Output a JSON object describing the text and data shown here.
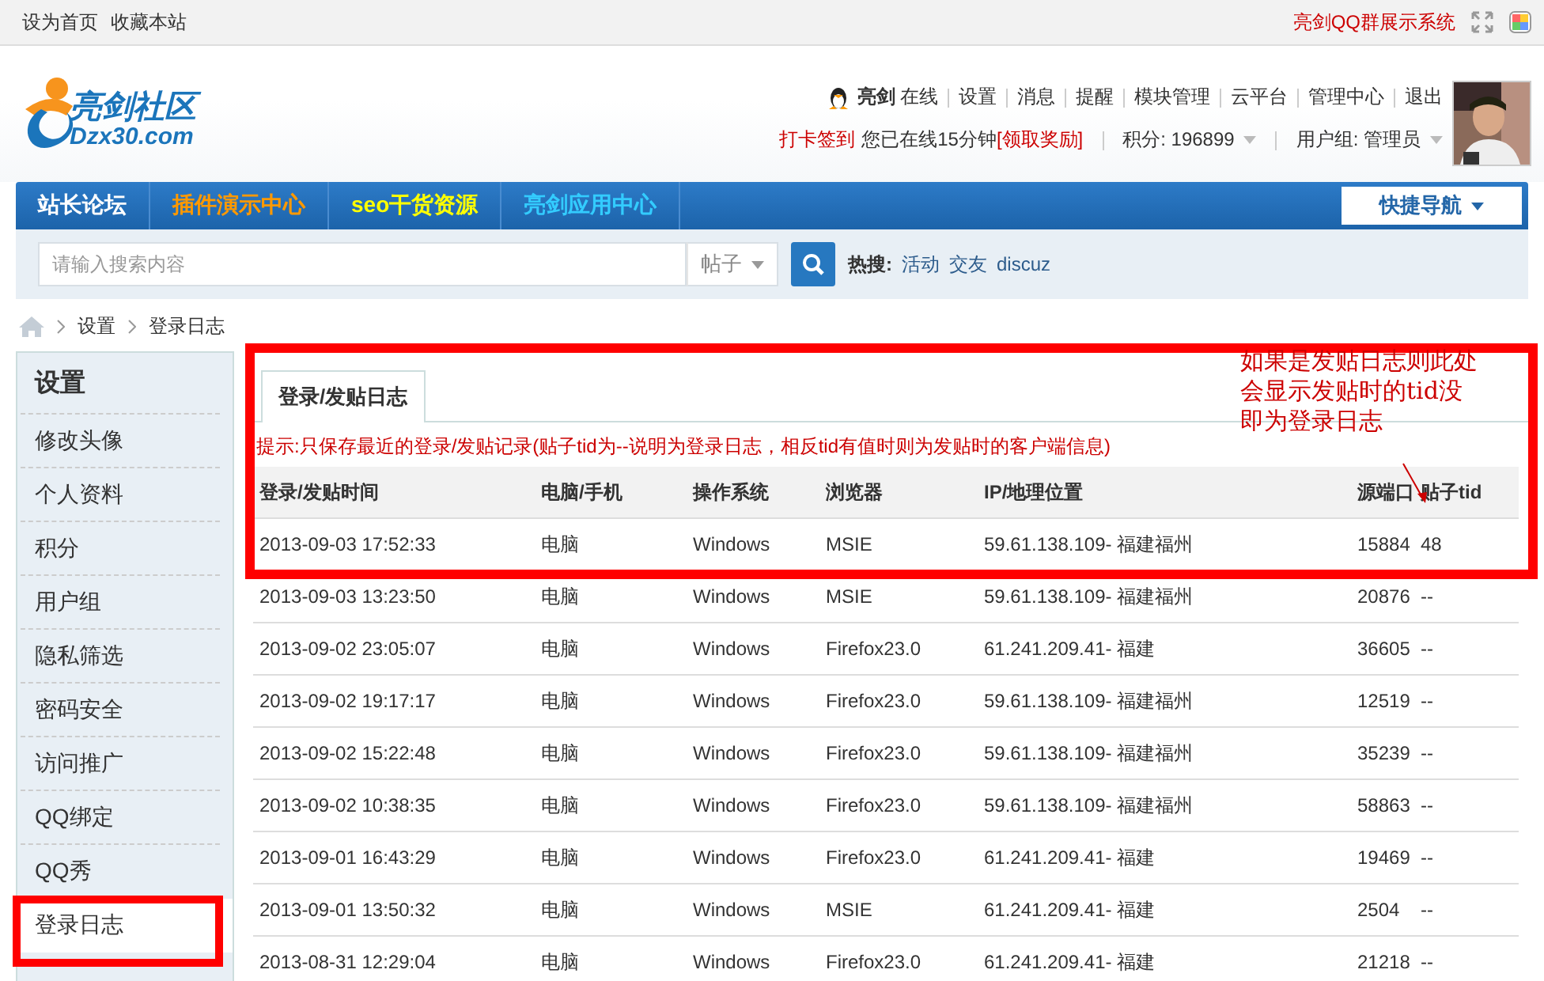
{
  "top_bar": {
    "links": [
      "设为首页",
      "收藏本站"
    ],
    "right_link": "亮剑QQ群展示系统"
  },
  "header": {
    "logo": {
      "title": "亮剑社区",
      "domain": "Dzx30.com"
    },
    "user": {
      "name": "亮剑",
      "status": "在线"
    },
    "user_links": [
      "设置",
      "消息",
      "提醒",
      "模块管理",
      "云平台",
      "管理中心",
      "退出"
    ],
    "checkin": "打卡签到",
    "online_text": "您已在线15分钟",
    "reward": "[领取奖励]",
    "points": "积分: 196899",
    "group": "用户组: 管理员"
  },
  "nav": {
    "items": [
      {
        "label": "站长论坛"
      },
      {
        "label": "插件演示中心"
      },
      {
        "label": "seo干货资源"
      },
      {
        "label": "亮剑应用中心"
      }
    ],
    "quick_nav": "快捷导航"
  },
  "search": {
    "placeholder": "请输入搜索内容",
    "type": "帖子",
    "hot_label": "热搜:",
    "hot": [
      "活动",
      "交友",
      "discuz"
    ]
  },
  "breadcrumb": [
    "设置",
    "登录日志"
  ],
  "sidebar": {
    "title": "设置",
    "items": [
      {
        "label": "修改头像",
        "selected": false
      },
      {
        "label": "个人资料",
        "selected": false
      },
      {
        "label": "积分",
        "selected": false
      },
      {
        "label": "用户组",
        "selected": false
      },
      {
        "label": "隐私筛选",
        "selected": false
      },
      {
        "label": "密码安全",
        "selected": false
      },
      {
        "label": "访问推广",
        "selected": false
      },
      {
        "label": "QQ绑定",
        "selected": false
      },
      {
        "label": "QQ秀",
        "selected": false
      },
      {
        "label": "登录日志",
        "selected": true
      }
    ]
  },
  "tabs": [
    {
      "label": "登录/发贴日志",
      "selected": true
    }
  ],
  "hint": "提示:只保存最近的登录/发贴记录(贴子tid为--说明为登录日志，相反tid有值时则为发贴时的客户端信息)",
  "table": {
    "columns": [
      "登录/发贴时间",
      "电脑/手机",
      "操作系统",
      "浏览器",
      "IP/地理位置",
      "源端口",
      "贴子tid"
    ],
    "rows": [
      [
        "2013-09-03 17:52:33",
        "电脑",
        "Windows",
        "MSIE",
        "59.61.138.109- 福建福州",
        "15884",
        "48"
      ],
      [
        "2013-09-03 13:23:50",
        "电脑",
        "Windows",
        "MSIE",
        "59.61.138.109- 福建福州",
        "20876",
        "--"
      ],
      [
        "2013-09-02 23:05:07",
        "电脑",
        "Windows",
        "Firefox23.0",
        "61.241.209.41- 福建",
        "36605",
        "--"
      ],
      [
        "2013-09-02 19:17:17",
        "电脑",
        "Windows",
        "Firefox23.0",
        "59.61.138.109- 福建福州",
        "12519",
        "--"
      ],
      [
        "2013-09-02 15:22:48",
        "电脑",
        "Windows",
        "Firefox23.0",
        "59.61.138.109- 福建福州",
        "35239",
        "--"
      ],
      [
        "2013-09-02 10:38:35",
        "电脑",
        "Windows",
        "Firefox23.0",
        "59.61.138.109- 福建福州",
        "58863",
        "--"
      ],
      [
        "2013-09-01 16:43:29",
        "电脑",
        "Windows",
        "Firefox23.0",
        "61.241.209.41- 福建",
        "19469",
        "--"
      ],
      [
        "2013-09-01 13:50:32",
        "电脑",
        "Windows",
        "MSIE",
        "61.241.209.41- 福建",
        "2504",
        "--"
      ],
      [
        "2013-08-31 12:29:04",
        "电脑",
        "Windows",
        "Firefox23.0",
        "61.241.209.41- 福建",
        "21218",
        "--"
      ]
    ]
  },
  "annotation": {
    "lines": [
      "如果是发贴日志则此处",
      "会显示发贴时的tid没",
      "即为登录日志"
    ]
  }
}
